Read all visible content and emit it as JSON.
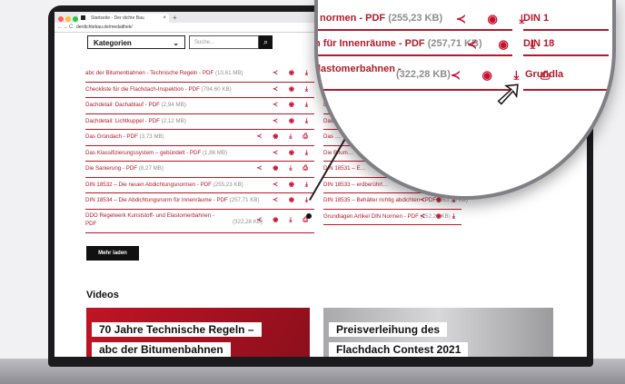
{
  "browser": {
    "tab_title": "Startseite - Der dichte Bau",
    "tab_close": "×",
    "new_tab": "+",
    "url": "derdichtebau.de/medaithek/",
    "nav_back": "←",
    "nav_forward": "→",
    "nav_reload": "C"
  },
  "filter": {
    "category_label": "Kategorien",
    "category_chevron": "⌄",
    "search_placeholder": "Suche...",
    "search_icon": "⌕"
  },
  "documents_left": [
    {
      "name": "abc der Bitumenbahnen - Technische Regeln - PDF",
      "size": "(10,61 MB)",
      "icons": "≺ ◉ ⤓"
    },
    {
      "name": "Checkliste für die Flachdach-Inspektion - PDF",
      "size": "(794,60 KB)",
      "icons": "≺ ◉ ⤓"
    },
    {
      "name": "Dachdetail: Dachablauf - PDF",
      "size": "(2,94 MB)",
      "icons": "≺ ◉ ⤓"
    },
    {
      "name": "Dachdetail: Lichtkuppel - PDF",
      "size": "(2,12 MB)",
      "icons": "≺ ◉ ⤓"
    },
    {
      "name": "Das Gründach - PDF",
      "size": "(3,73 MB)",
      "icons": "≺ ◉ ⤓ ⎙"
    },
    {
      "name": "Das Klassifizierungssystem – gebündelt - PDF",
      "size": "(1,86 MB)",
      "icons": "≺ ◉ ⤓"
    },
    {
      "name": "Die Sanierung - PDF",
      "size": "(8,27 MB)",
      "icons": "≺ ◉ ⤓ ⎙"
    },
    {
      "name": "DIN 18532 – Die neuen Abdichtungsnormen - PDF",
      "size": "(255,23 KB)",
      "icons": "≺ ◉ ⤓"
    },
    {
      "name": "DIN 18534 – Die Abdichtungsnorm für Innenräume - PDF",
      "size": "(257,71 KB)",
      "icons": "≺ ◉ ⤓"
    }
  ],
  "documents_left_last": {
    "line1": "DDO Regelwerk Kunststoff- und Elastomerbahnen -",
    "line2": "PDF",
    "size": "(322,28 KB)",
    "icons": "≺ ◉ ⤓ ⎙"
  },
  "documents_right": [
    {
      "name": "Der Bitumenbahn",
      "size": "",
      "icons": "⤓ ⎙"
    },
    {
      "name": "Der Bitumenbahn",
      "size": "",
      "icons": "⤓"
    },
    {
      "name": "Dichte Dächer",
      "size": "",
      "icons": "⤓"
    },
    {
      "name": "Das …",
      "size": "",
      "icons": "⤓"
    },
    {
      "name": "Das …",
      "size": "",
      "icons": "⤓"
    },
    {
      "name": "Die Bitum…",
      "size": "",
      "icons": "⤓ ⎙"
    },
    {
      "name": "DIN 18531 – E…",
      "size": "",
      "icons": "⤓ ⎙"
    },
    {
      "name": "DIN 18533 – erdberührt…",
      "size": "",
      "icons": "≺ ◉ ⤓"
    },
    {
      "name": "DIN 18535 – Behälter richtig abdichten - PDF",
      "size": "(263,19 KB)",
      "icons": "≺ ◉ ⤓"
    },
    {
      "name": "Grundlagen Artikel DIN Normen - PDF",
      "size": "(252,28 KB)",
      "icons": "≺ ◉ ⤓"
    }
  ],
  "more_button": "Mehr laden",
  "videos": {
    "title": "Videos",
    "video1_line1": "70 Jahre Technische Regeln –",
    "video1_line2": "abc der Bitumenbahnen",
    "video2_line1": "Preisverleihung des",
    "video2_line2": "Flachdach Contest 2021"
  },
  "side_buttons": {
    "star": "★",
    "calendar": "▦"
  },
  "magnifier": {
    "row1_name": "normen - PDF",
    "row1_size": "(255,23 KB)",
    "row1_right": "DIN 1",
    "row2_name": "n für Innenräume - PDF",
    "row2_size": "(257,71 KB)",
    "row2_right": "DIN 18",
    "row3_name": "lastomerbahnen -",
    "row3_size": "(322,28 KB)",
    "row3_right": "Grundla",
    "icons": "≺ ◉ ⤓",
    "icons_print": "≺ ◉ ⤓ ⎙",
    "cursor": "➚"
  }
}
